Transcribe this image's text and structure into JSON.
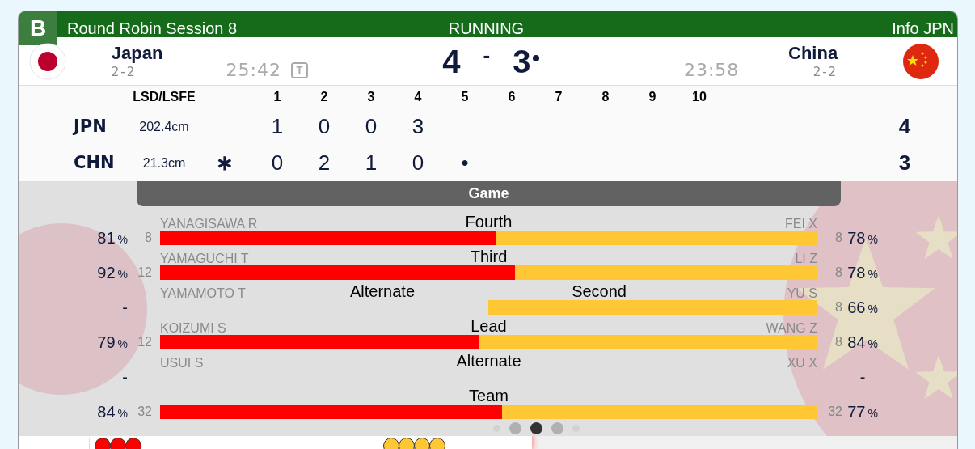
{
  "header": {
    "badge": "B",
    "title": "Round Robin Session 8",
    "status": "RUNNING",
    "info": "Info JPN"
  },
  "teams": [
    {
      "kind": "japan",
      "name": "Japan",
      "record": "2-2",
      "time": "25:42",
      "timeout": "T",
      "score": "4",
      "hammer": false
    },
    {
      "kind": "china",
      "name": "China",
      "record": "2-2",
      "time": "23:58",
      "score": "3",
      "hammer": true
    }
  ],
  "score_separator": "-",
  "linescore": {
    "columns": [
      "LSD/LSFE",
      "1",
      "2",
      "3",
      "4",
      "5",
      "6",
      "7",
      "8",
      "9",
      "10"
    ],
    "rows": [
      {
        "code": "JPN",
        "lsd": "202.4cm",
        "ends": [
          "1",
          "0",
          "0",
          "3"
        ],
        "total": "4"
      },
      {
        "code": "CHN",
        "lsd": "21.3cm",
        "hammer_mark": "∗",
        "ends": [
          "0",
          "2",
          "1",
          "0",
          "•"
        ],
        "total": "3"
      }
    ]
  },
  "game": {
    "title": "Game",
    "rows": [
      {
        "kind": "full",
        "roles": [
          {
            "kind": "center",
            "text": "Fourth"
          }
        ],
        "jpn_name": "YANAGISAWA R",
        "chn_name": "FEI X",
        "jpn_shots": "8",
        "chn_shots": "8",
        "jpn_pct": {
          "value": "81",
          "unit": "%"
        },
        "chn_pct": {
          "value": "78",
          "unit": "%"
        },
        "level": 0.51
      },
      {
        "kind": "full",
        "roles": [
          {
            "kind": "center",
            "text": "Third"
          }
        ],
        "jpn_name": "YAMAGUCHI T",
        "chn_name": "LI Z",
        "jpn_shots": "12",
        "chn_shots": "8",
        "jpn_pct": {
          "value": "92",
          "unit": "%"
        },
        "chn_pct": {
          "value": "78",
          "unit": "%"
        },
        "level": 0.54
      },
      {
        "kind": "half",
        "roles": [
          {
            "kind": "left",
            "text": "Alternate"
          },
          {
            "kind": "right",
            "text": "Second"
          }
        ],
        "jpn_name": "YAMAMOTO T",
        "chn_name": "YU S",
        "chn_shots": "8",
        "jpn_pct": {
          "value": "-"
        },
        "chn_pct": {
          "value": "66",
          "unit": "%"
        }
      },
      {
        "kind": "full",
        "roles": [
          {
            "kind": "center",
            "text": "Lead"
          }
        ],
        "jpn_name": "KOIZUMI S",
        "chn_name": "WANG Z",
        "jpn_shots": "12",
        "chn_shots": "8",
        "jpn_pct": {
          "value": "79",
          "unit": "%"
        },
        "chn_pct": {
          "value": "84",
          "unit": "%"
        },
        "level": 0.485
      },
      {
        "kind": "none",
        "roles": [
          {
            "kind": "center",
            "text": "Alternate"
          }
        ],
        "jpn_name": "USUI S",
        "chn_name": "XU X",
        "jpn_pct": {
          "value": "-"
        },
        "chn_pct": {
          "value": "-"
        }
      },
      {
        "kind": "full",
        "roles": [
          {
            "kind": "center",
            "text": "Team"
          }
        ],
        "jpn_shots": "32",
        "chn_shots": "32",
        "jpn_pct": {
          "value": "84",
          "unit": "%"
        },
        "chn_pct": {
          "value": "77",
          "unit": "%"
        },
        "level": 0.52
      }
    ],
    "pages": [
      {
        "selected": false
      },
      {
        "selected": false
      },
      {
        "selected": true
      },
      {
        "selected": false
      },
      {
        "selected": false
      }
    ]
  },
  "stones": {
    "jpn": [
      {
        "color": "#ff0000"
      },
      {
        "color": "#ff0000"
      },
      {
        "color": "#ff0000"
      }
    ],
    "chn": [
      {
        "color": "#ffc734"
      },
      {
        "color": "#ffc734"
      },
      {
        "color": "#ffc734"
      },
      {
        "color": "#ffc734"
      }
    ]
  }
}
